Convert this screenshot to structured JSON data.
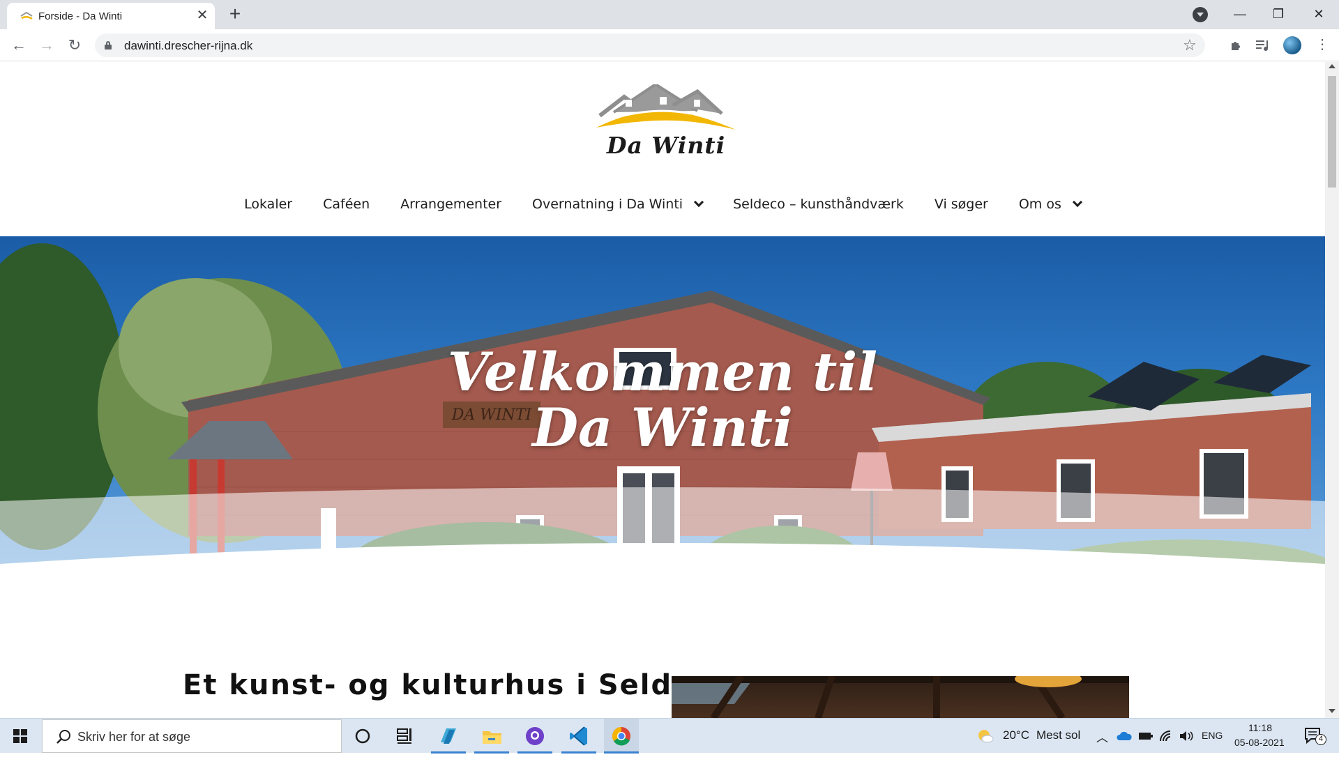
{
  "browser": {
    "tab_title": "Forside - Da Winti",
    "tab_close": "✕",
    "new_tab": "+",
    "url": "dawinti.drescher-rijna.dk",
    "window_controls": {
      "minimize": "—",
      "maximize": "❐",
      "close": "✕"
    },
    "icons": [
      "back-arrow-icon",
      "forward-arrow-icon",
      "reload-icon",
      "lock-icon",
      "star-icon",
      "extensions-icon",
      "media-control-icon",
      "profile-avatar",
      "menu-icon",
      "tab-search-icon"
    ]
  },
  "site": {
    "logo_text": "Da Winti",
    "nav": [
      {
        "label": "Lokaler",
        "has_dropdown": false
      },
      {
        "label": "Caféen",
        "has_dropdown": false
      },
      {
        "label": "Arrangementer",
        "has_dropdown": false
      },
      {
        "label": "Overnatning i Da Winti",
        "has_dropdown": true
      },
      {
        "label": "Seldeco – kunsthåndværk",
        "has_dropdown": false
      },
      {
        "label": "Vi søger",
        "has_dropdown": false
      },
      {
        "label": "Om os",
        "has_dropdown": true
      }
    ],
    "hero": {
      "title_line1": "Velkommen til",
      "title_line2": "Da Winti",
      "building_sign": "DA WINTI"
    },
    "section_heading": "Et kunst- og kulturhus i Selde"
  },
  "taskbar": {
    "search_placeholder": "Skriv her for at søge",
    "apps": [
      "cortana-icon",
      "task-view-icon",
      "app-icon",
      "file-explorer-icon",
      "github-desktop-icon",
      "vscode-icon",
      "chrome-icon"
    ],
    "weather_temp": "20°C",
    "weather_desc": "Mest sol",
    "language": "ENG",
    "time": "11:18",
    "date": "05-08-2021",
    "notifications": "4"
  },
  "colors": {
    "accent_yellow": "#f2b705",
    "roof_grey": "#8e8e8e",
    "chrome_blue": "#1a73e8",
    "brick": "#a45a4e"
  }
}
